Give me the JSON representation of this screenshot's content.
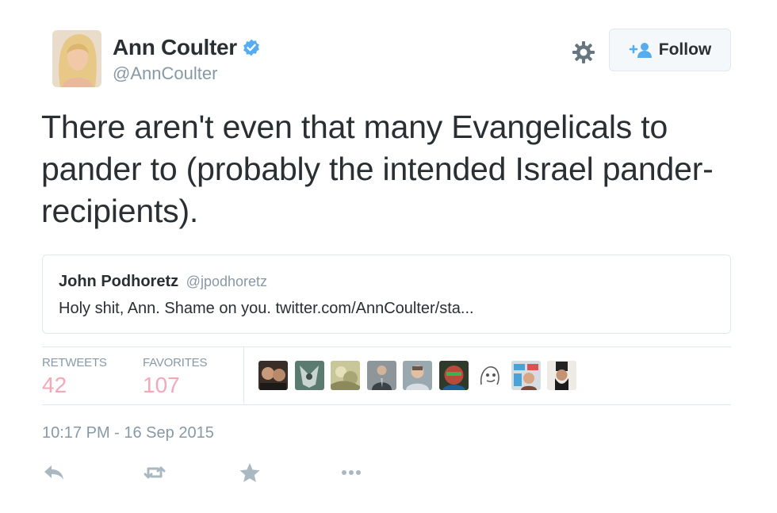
{
  "author": {
    "name": "Ann Coulter",
    "handle": "@AnnCoulter",
    "verified": true
  },
  "follow_button": {
    "label": "Follow",
    "icon": "add-user-icon"
  },
  "settings_icon": "gear-icon",
  "tweet": {
    "text": "There aren't even that many Evangelicals to pander to (probably the intended Israel pander-recipients).",
    "timestamp": "10:17 PM - 16 Sep 2015"
  },
  "quoted_tweet": {
    "name": "John Podhoretz",
    "handle": "@jpodhoretz",
    "text": "Holy shit, Ann. Shame on you. twitter.com/AnnCoulter/sta..."
  },
  "stats": {
    "retweets_label": "RETWEETS",
    "retweets_count": "42",
    "favorites_label": "FAVORITES",
    "favorites_count": "107"
  },
  "favoriters_shown": 9,
  "actions": [
    "reply-icon",
    "retweet-icon",
    "favorite-icon",
    "more-icon"
  ],
  "colors": {
    "text": "#292f33",
    "muted": "#8899a6",
    "count": "#f4a8b8",
    "border": "#e1e8ed",
    "verified": "#55acee",
    "follow_icon": "#55acee",
    "action_icon": "#aab8c2"
  }
}
